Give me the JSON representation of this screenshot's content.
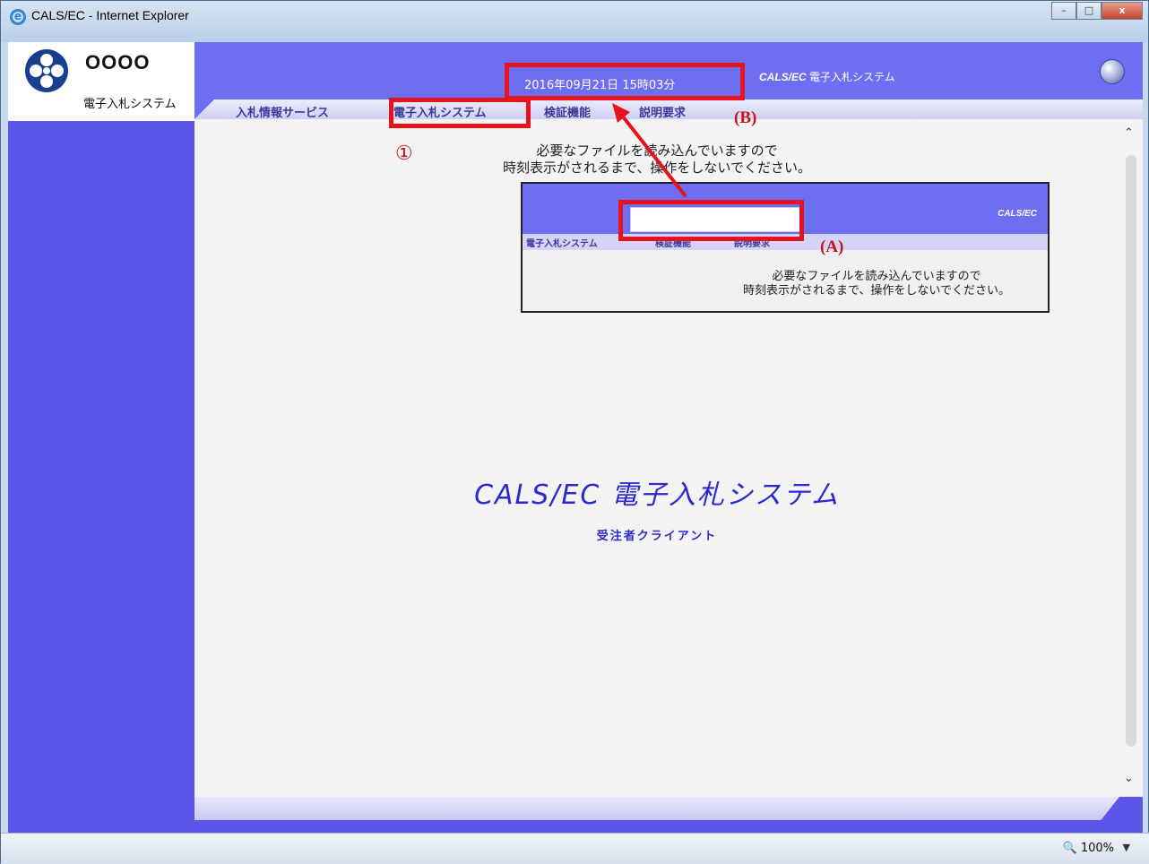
{
  "window": {
    "title": "CALS/EC - Internet Explorer",
    "minimize": "–",
    "maximize": "□",
    "close": "x"
  },
  "logo": {
    "name": "OOOO",
    "subtitle": "電子入札システム"
  },
  "header": {
    "datetime": "2016年09月21日 15時03分",
    "brand_en": "CALS/EC",
    "brand_jp": "電子入札システム"
  },
  "nav": [
    {
      "label": "入札情報サービス"
    },
    {
      "label": "電子入札システム"
    },
    {
      "label": "検証機能"
    },
    {
      "label": "説明要求"
    }
  ],
  "loading": {
    "line1": "必要なファイルを読み込んでいますので",
    "line2": "時刻表示がされるまで、操作をしないでください。"
  },
  "inset": {
    "brand": "CALS/EC",
    "nav": [
      "電子入札システム",
      "検証機能",
      "説明要求"
    ],
    "line1": "必要なファイルを読み込んでいますので",
    "line2": "時刻表示がされるまで、操作をしないでください。"
  },
  "annotations": {
    "circle_one": "①",
    "label_a": "(A)",
    "label_b": "(B)"
  },
  "hero": {
    "title": "CALS/EC 電子入札システム",
    "subtitle": "受注者クライアント"
  },
  "statusbar": {
    "zoom": "100%"
  }
}
